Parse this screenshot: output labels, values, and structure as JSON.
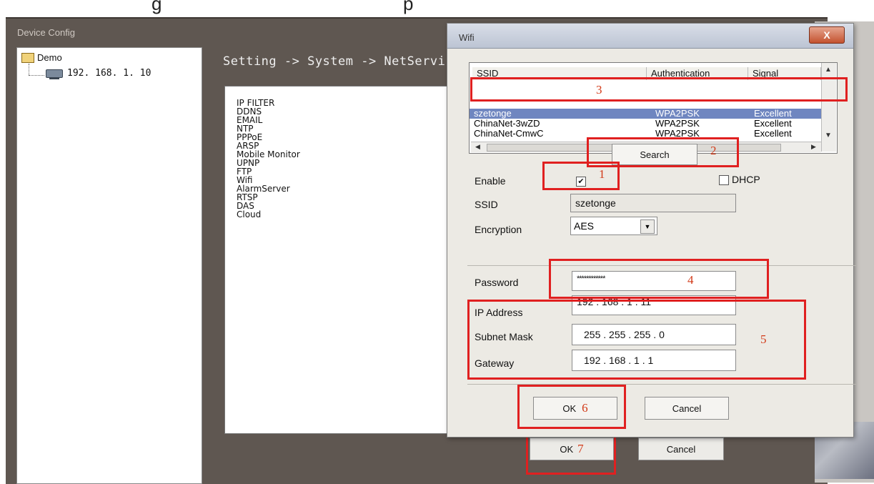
{
  "top_fragments": [
    "g",
    "p"
  ],
  "outer_window": {
    "title": "Device Config"
  },
  "tree": {
    "root_label": "Demo",
    "child_label": "192. 168. 1. 10"
  },
  "breadcrumb": "Setting -> System -> NetServi",
  "service_list": [
    "IP FILTER",
    "DDNS",
    "EMAIL",
    "NTP",
    "PPPoE",
    "ARSP",
    "Mobile Monitor",
    "UPNP",
    "FTP",
    "Wifi",
    "AlarmServer",
    "RTSP",
    "DAS",
    "Cloud"
  ],
  "outer_buttons": {
    "ok": "OK",
    "ok_step": "7",
    "cancel": "Cancel"
  },
  "dialog": {
    "title": "Wifi",
    "close_label": "X",
    "table": {
      "headers": [
        "SSID",
        "Authentication",
        "Signal"
      ],
      "rows": [
        {
          "ssid": "szetonge",
          "auth": "WPA2PSK",
          "signal": "Excellent",
          "selected": true
        },
        {
          "ssid": "ChinaNet-3wZD",
          "auth": "WPA2PSK",
          "signal": "Excellent",
          "selected": false
        },
        {
          "ssid": "ChinaNet-CmwC",
          "auth": "WPA2PSK",
          "signal": "Excellent",
          "selected": false
        }
      ],
      "hscroll_label": "III"
    },
    "search_label": "Search",
    "enable_label": "Enable",
    "enable_checked": "✔",
    "dhcp_label": "DHCP",
    "ssid_label": "SSID",
    "ssid_value": "szetonge",
    "encryption_label": "Encryption",
    "encryption_value": "AES",
    "password_label": "Password",
    "password_value": "************",
    "ip_label": "IP Address",
    "ip_value": "192 . 168 . 1 . 11",
    "mask_label": "Subnet Mask",
    "mask_value": "255 . 255 . 255 . 0",
    "gateway_label": "Gateway",
    "gateway_value": "192 . 168 . 1 . 1",
    "ok_label": "OK",
    "ok_step": "6",
    "cancel_label": "Cancel"
  },
  "steps": {
    "enable": "1",
    "search": "2",
    "ssid_row": "3",
    "password": "4",
    "network": "5"
  },
  "colors": {
    "highlight_red": "#e02020",
    "selection_blue": "#6f86c0",
    "step_number": "#d23a18"
  }
}
